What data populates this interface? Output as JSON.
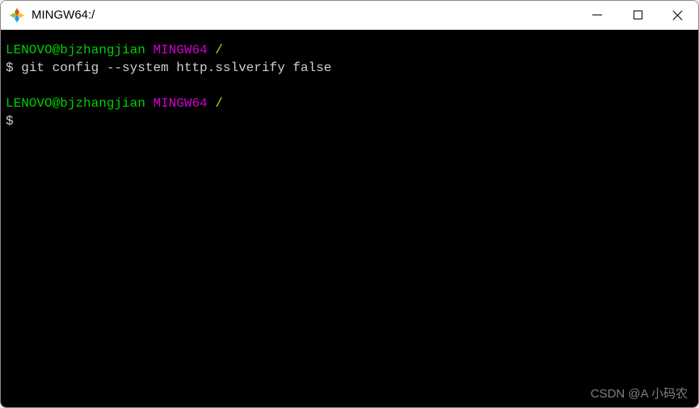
{
  "window": {
    "title": "MINGW64:/"
  },
  "terminal": {
    "lines": [
      {
        "user_host": "LENOVO@bjzhangjian",
        "env": "MINGW64",
        "path": "/"
      },
      {
        "prompt": "$",
        "command": "git config --system http.sslverify false"
      },
      {
        "blank": ""
      },
      {
        "user_host": "LENOVO@bjzhangjian",
        "env": "MINGW64",
        "path": "/"
      },
      {
        "prompt": "$",
        "command": ""
      }
    ]
  },
  "watermark": "CSDN @A 小码农"
}
